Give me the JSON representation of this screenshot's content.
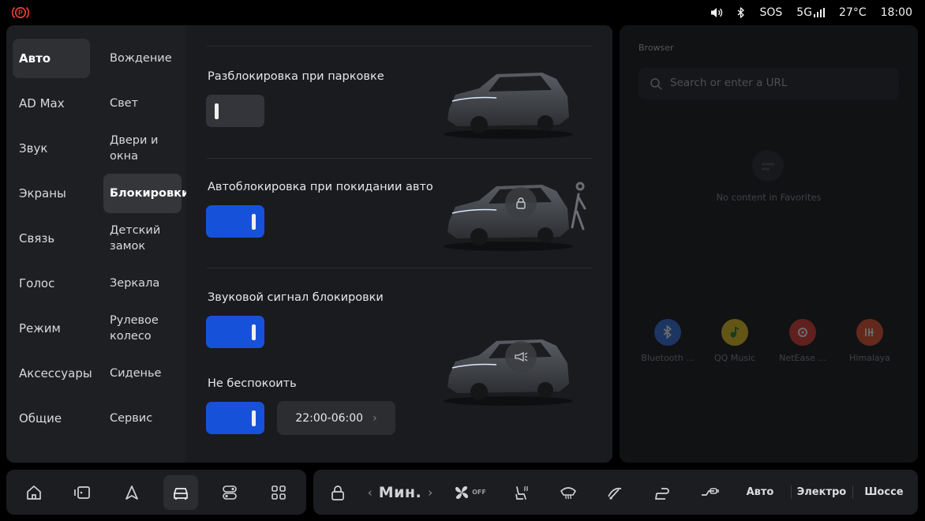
{
  "status_bar": {
    "alert_icon": "parking-brake-icon",
    "sound_icon": "volume-icon",
    "bluetooth_icon": "bluetooth-icon",
    "sos": "SOS",
    "network": "5G",
    "temperature": "27°C",
    "time": "18:00",
    "accent": "#e53935"
  },
  "nav_primary": {
    "items": [
      "Авто",
      "AD Max",
      "Звук",
      "Экраны",
      "Связь",
      "Голос",
      "Режим",
      "Аксессуары",
      "Общие"
    ],
    "active": "Авто"
  },
  "nav_secondary": {
    "items": [
      "Вождение",
      "Свет",
      "Двери и окна",
      "Блокировки",
      "Детский замок",
      "Зеркала",
      "Рулевое колесо",
      "Сиденье",
      "Сервис"
    ],
    "active": "Блокировки"
  },
  "options": {
    "park_unlock": {
      "label": "Разблокировка при парковке",
      "enabled": false
    },
    "walkaway_lock": {
      "label": "Автоблокировка при покидании авто",
      "enabled": true,
      "icon": "lock-icon"
    },
    "lock_sound": {
      "label": "Звуковой сигнал блокировки",
      "enabled": true,
      "icon": "horn-icon"
    },
    "dnd": {
      "label": "Не беспокоить",
      "enabled": true,
      "time_range": "22:00-06:00"
    }
  },
  "browser": {
    "title": "Browser",
    "search_placeholder": "Search or enter a URL",
    "empty_text": "No content in Favorites",
    "apps": [
      {
        "name": "Bluetooth ...",
        "icon": "bluetooth-icon",
        "color": "#2f6fe0"
      },
      {
        "name": "QQ Music",
        "icon": "qq-music-icon",
        "color": "#e6c21a"
      },
      {
        "name": "NetEase ...",
        "icon": "netease-music-icon",
        "color": "#e03a2f"
      },
      {
        "name": "Himalaya",
        "icon": "himalaya-icon",
        "color": "#e8502a"
      }
    ]
  },
  "dock": {
    "left": [
      "home-icon",
      "cards-icon",
      "navigation-icon",
      "car-icon",
      "toggles-icon",
      "apps-grid-icon"
    ],
    "active": "car-icon",
    "climate": {
      "fan_speed": "Мин.",
      "fan_state": "OFF",
      "modes": [
        "Авто",
        "Электро",
        "Шоссе"
      ]
    }
  },
  "colors": {
    "toggle_on": "#1652d9",
    "toggle_off": "#34353a",
    "panel": "#1e1f22",
    "background": "#000000"
  }
}
